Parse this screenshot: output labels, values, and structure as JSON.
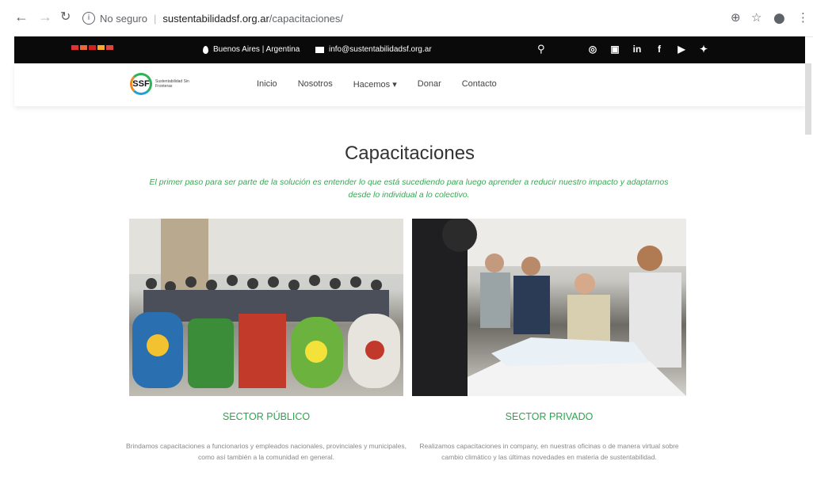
{
  "browser": {
    "security": "No seguro",
    "domain": "sustentabilidadsf.org.ar",
    "path": "/capacitaciones/"
  },
  "topbar": {
    "location": "Buenos Aires | Argentina",
    "email": "info@sustentabilidadsf.org.ar",
    "social": [
      "whatsapp-icon",
      "instagram-icon",
      "linkedin-icon",
      "facebook-icon",
      "youtube-icon",
      "twitter-icon"
    ]
  },
  "logo": {
    "mark": "SSF",
    "text": "Sustentabilidad Sin Fronteras"
  },
  "menu": {
    "items": [
      "Inicio",
      "Nosotros",
      "Hacemos ▾",
      "Donar",
      "Contacto"
    ]
  },
  "page": {
    "title": "Capacitaciones",
    "subtitle": "El primer paso para ser parte de la solución es entender lo que está sucediendo para luego aprender a reducir nuestro impacto y adaptarnos desde lo individual a lo colectivo."
  },
  "sectors": [
    {
      "heading": "SECTOR PÚBLICO",
      "text": "Brindamos capacitaciones a funcionarios y empleados nacionales, provinciales y municipales, como así también a la comunidad en general."
    },
    {
      "heading": "SECTOR PRIVADO",
      "text": "Realizamos capacitaciones in company, en nuestras oficinas o de manera virtual sobre cambio climático y las últimas novedades en materia de sustentabilidad."
    }
  ],
  "colors": {
    "accent_green": "#2aa64d",
    "topbar": "#0a0a0a"
  }
}
